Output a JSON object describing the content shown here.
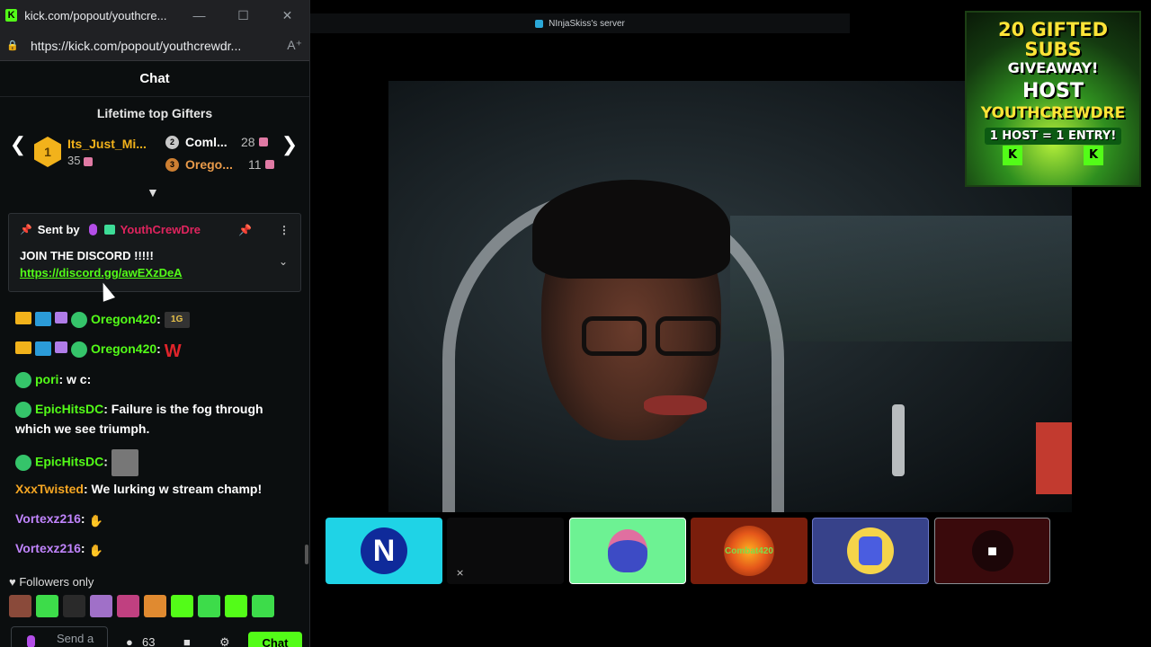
{
  "browser": {
    "tab_title": "kick.com/popout/youthcre...",
    "url": "https://kick.com/popout/youthcrewdr...",
    "favicon": "K",
    "minimize": "—",
    "maximize": "☐",
    "close": "✕"
  },
  "chat": {
    "header": "Chat",
    "top_gifters": {
      "title": "Lifetime top Gifters",
      "first": {
        "rank": "1",
        "name": "Its_Just_Mi...",
        "count": "35"
      },
      "second": {
        "rank": "2",
        "name": "Coml...",
        "count": "28"
      },
      "third": {
        "rank": "3",
        "name": "Orego...",
        "count": "11"
      }
    },
    "pinned": {
      "sent_by_label": "Sent by",
      "user": "YouthCrewDre",
      "text": "JOIN THE DISCORD !!!!!",
      "link": "https://discord.gg/awEXzDeA"
    },
    "messages": [
      {
        "user": "Oregon420",
        "text": ":",
        "emote": "1G"
      },
      {
        "user": "Oregon420",
        "text": ":",
        "emote": "W"
      },
      {
        "user": "pori",
        "text": ": w c:"
      },
      {
        "user": "EpicHitsDC",
        "text": ": Failure is the fog through which we see triumph."
      },
      {
        "user": "EpicHitsDC",
        "text": ":"
      },
      {
        "user": "XxxTwisted",
        "text": ": We lurking w stream champ!"
      },
      {
        "user": "Vortexz216",
        "text": ":"
      },
      {
        "user": "Vortexz216",
        "text": ":"
      }
    ],
    "followers_only": "Followers only",
    "send_placeholder": "Send a",
    "viewer_count": "63",
    "chat_button": "Chat"
  },
  "stream": {
    "server_title": "NInjaSkiss's server",
    "giveaway": {
      "line1": "20 GIFTED SUBS",
      "line2": "GIVEAWAY!",
      "host": "HOST",
      "name": "YOUTHCREWDRE",
      "entry": "1 HOST = 1 ENTRY!",
      "k": "K"
    },
    "tiles": [
      {
        "name": "N"
      },
      {
        "name": "muted"
      },
      {
        "name": "house"
      },
      {
        "name": "Combat420"
      },
      {
        "name": "robot"
      },
      {
        "name": "camera-off"
      }
    ]
  },
  "colors": {
    "kick_green": "#53fc18",
    "gold": "#f2b21b",
    "pinned_user": "#e0245e"
  }
}
